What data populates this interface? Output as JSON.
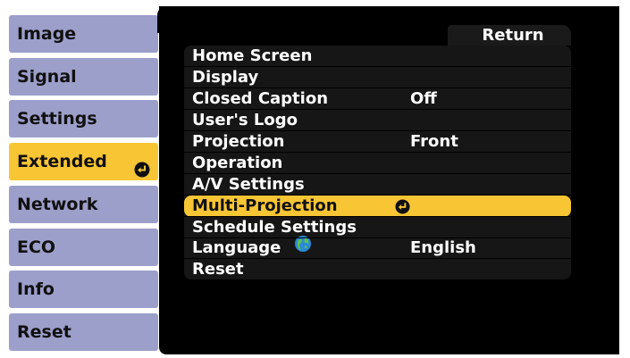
{
  "menu_tabs": [
    {
      "label": "Image"
    },
    {
      "label": "Signal"
    },
    {
      "label": "Settings"
    },
    {
      "label": "Extended",
      "active": true
    },
    {
      "label": "Network"
    },
    {
      "label": "ECO"
    },
    {
      "label": "Info"
    },
    {
      "label": "Reset"
    }
  ],
  "return_label": "Return",
  "submenu": [
    {
      "label": "Home Screen",
      "value": ""
    },
    {
      "label": "Display",
      "value": ""
    },
    {
      "label": "Closed Caption",
      "value": "Off"
    },
    {
      "label": "User's Logo",
      "value": ""
    },
    {
      "label": "Projection",
      "value": "Front"
    },
    {
      "label": "Operation",
      "value": ""
    },
    {
      "label": "A/V Settings",
      "value": ""
    },
    {
      "label": "Multi-Projection",
      "value": "",
      "selected": true
    },
    {
      "label": "Schedule Settings",
      "value": ""
    },
    {
      "label": "Language",
      "value": "English"
    },
    {
      "label": "Reset",
      "value": ""
    }
  ],
  "colors": {
    "tab_bg": "#9b9fc9",
    "active_bg": "#f8c535",
    "panel_bg": "#000000"
  },
  "icons": {
    "enter": "enter-arrow-icon",
    "globe": "globe-icon"
  }
}
